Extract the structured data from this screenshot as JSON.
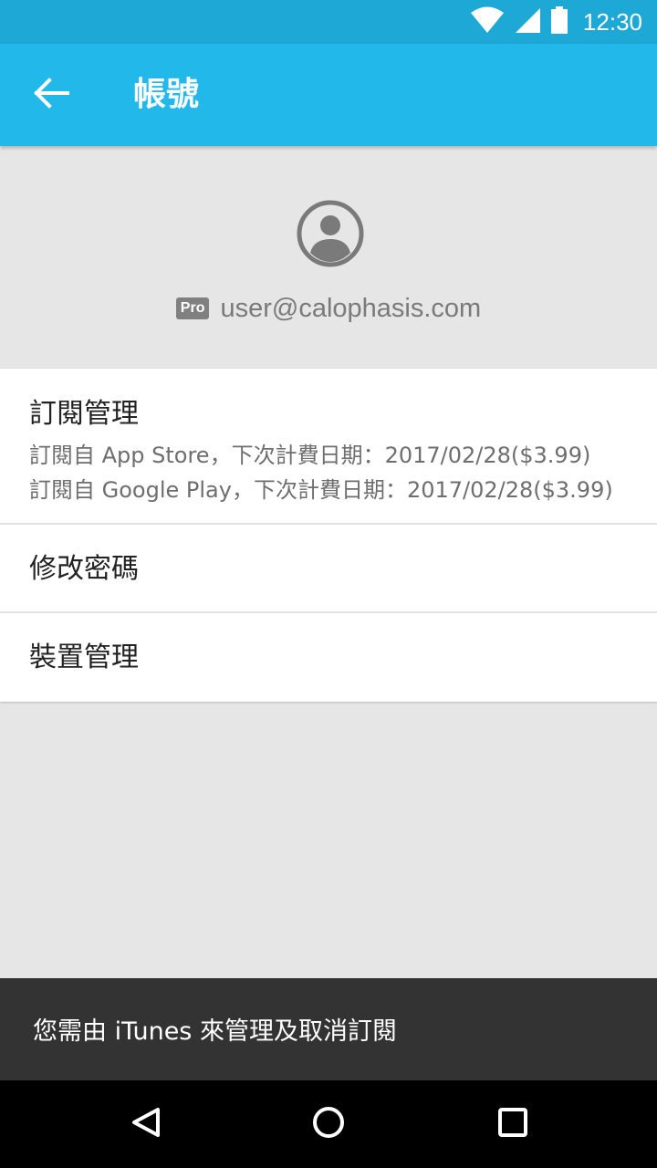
{
  "status_bar": {
    "time": "12:30",
    "icons": [
      "wifi-icon",
      "signal-icon",
      "battery-icon"
    ]
  },
  "app_bar": {
    "title": "帳號",
    "back_icon": "arrow-left-icon"
  },
  "profile": {
    "avatar_icon": "account-circle-icon",
    "badge": "Pro",
    "email": "user@calophasis.com"
  },
  "menu": {
    "subscription": {
      "title": "訂閱管理",
      "details": [
        "訂閱自 App Store，下次計費日期：2017/02/28($3.99)",
        "訂閱自 Google Play，下次計費日期：2017/02/28($3.99)"
      ]
    },
    "change_password": {
      "title": "修改密碼"
    },
    "device_management": {
      "title": "裝置管理"
    }
  },
  "snackbar": {
    "message": "您需由 iTunes 來管理及取消訂閱"
  },
  "nav_bar": {
    "icons": [
      "back-triangle-icon",
      "home-circle-icon",
      "recents-square-icon"
    ]
  },
  "colors": {
    "status_bar": "#1ea8d6",
    "app_bar": "#22b8ea",
    "background": "#e6e6e6",
    "snackbar": "#333333",
    "nav_bar": "#000000"
  }
}
